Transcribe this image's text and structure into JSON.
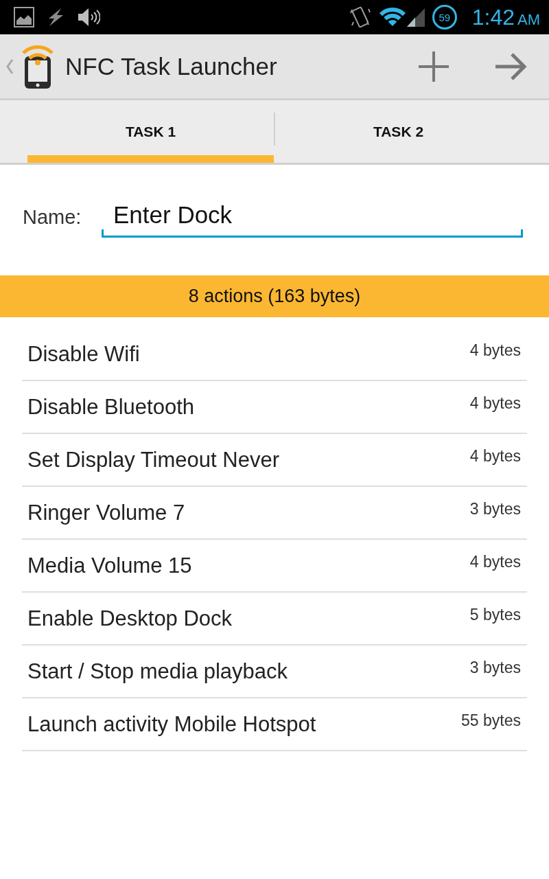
{
  "status_bar": {
    "timer_badge": "59",
    "time": "1:42",
    "meridiem": "AM"
  },
  "action_bar": {
    "title": "NFC Task Launcher"
  },
  "tabs": [
    {
      "label": "TASK 1",
      "selected": true
    },
    {
      "label": "TASK 2",
      "selected": false
    }
  ],
  "name_field": {
    "label": "Name:",
    "value": "Enter Dock",
    "focused": true
  },
  "summary": "8 actions (163 bytes)",
  "actions": [
    {
      "name": "Disable Wifi",
      "size": "4 bytes"
    },
    {
      "name": "Disable Bluetooth",
      "size": "4 bytes"
    },
    {
      "name": "Set Display Timeout Never",
      "size": "4 bytes"
    },
    {
      "name": "Ringer Volume 7",
      "size": "3 bytes"
    },
    {
      "name": "Media Volume 15",
      "size": "4 bytes"
    },
    {
      "name": "Enable Desktop Dock",
      "size": "5 bytes"
    },
    {
      "name": "Start / Stop media playback",
      "size": "3 bytes"
    },
    {
      "name": "Launch activity Mobile Hotspot",
      "size": "55 bytes"
    }
  ]
}
